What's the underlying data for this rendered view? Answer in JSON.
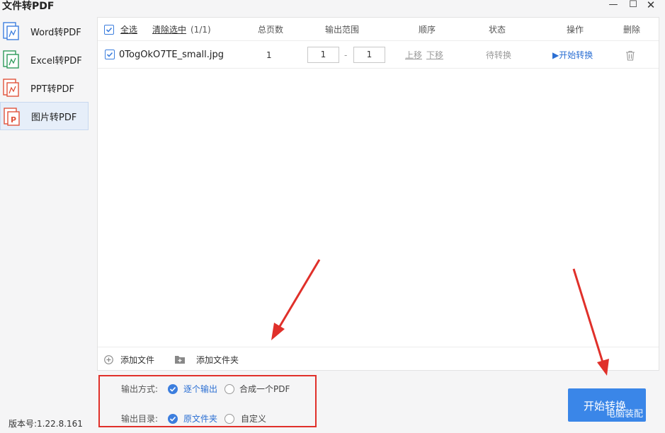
{
  "window": {
    "title": "文件转PDF",
    "min_glyph": "—",
    "max_glyph": "☐",
    "close_glyph": "✕"
  },
  "sidebar": {
    "items": [
      {
        "label": "Word转PDF",
        "icon": "word-doc-icon",
        "color": "#3c7ede"
      },
      {
        "label": "Excel转PDF",
        "icon": "excel-doc-icon",
        "color": "#2e9a5a"
      },
      {
        "label": "PPT转PDF",
        "icon": "ppt-doc-icon",
        "color": "#e0533b"
      },
      {
        "label": "图片转PDF",
        "icon": "image-doc-icon",
        "color": "#e0533b",
        "active": true
      }
    ],
    "version": "版本号:1.22.8.161"
  },
  "table": {
    "select_all": "全选",
    "clear_selection": "清除选中",
    "selection_count": "(1/1)",
    "columns": {
      "pages": "总页数",
      "range": "输出范围",
      "order": "顺序",
      "status": "状态",
      "action": "操作",
      "delete": "删除"
    },
    "rows": [
      {
        "checked": true,
        "filename": "0TogOkO7TE_small.jpg",
        "pages": "1",
        "range_from": "1",
        "range_sep": "-",
        "range_to": "1",
        "move_up": "上移",
        "move_down": "下移",
        "status": "待转换",
        "action": "▶开始转换"
      }
    ]
  },
  "footer": {
    "add_file": "添加文件",
    "add_folder": "添加文件夹"
  },
  "output": {
    "mode_label": "输出方式:",
    "mode_options": [
      "逐个输出",
      "合成一个PDF"
    ],
    "mode_selected": "逐个输出",
    "dir_label": "输出目录:",
    "dir_options": [
      "原文件夹",
      "自定义"
    ],
    "dir_selected": "原文件夹"
  },
  "start_button": {
    "label": "开始转换"
  },
  "watermark": "电脑装配",
  "colors": {
    "accent": "#3c7ede",
    "annotation_red": "#e0302a",
    "button_blue": "#3a86e8"
  }
}
